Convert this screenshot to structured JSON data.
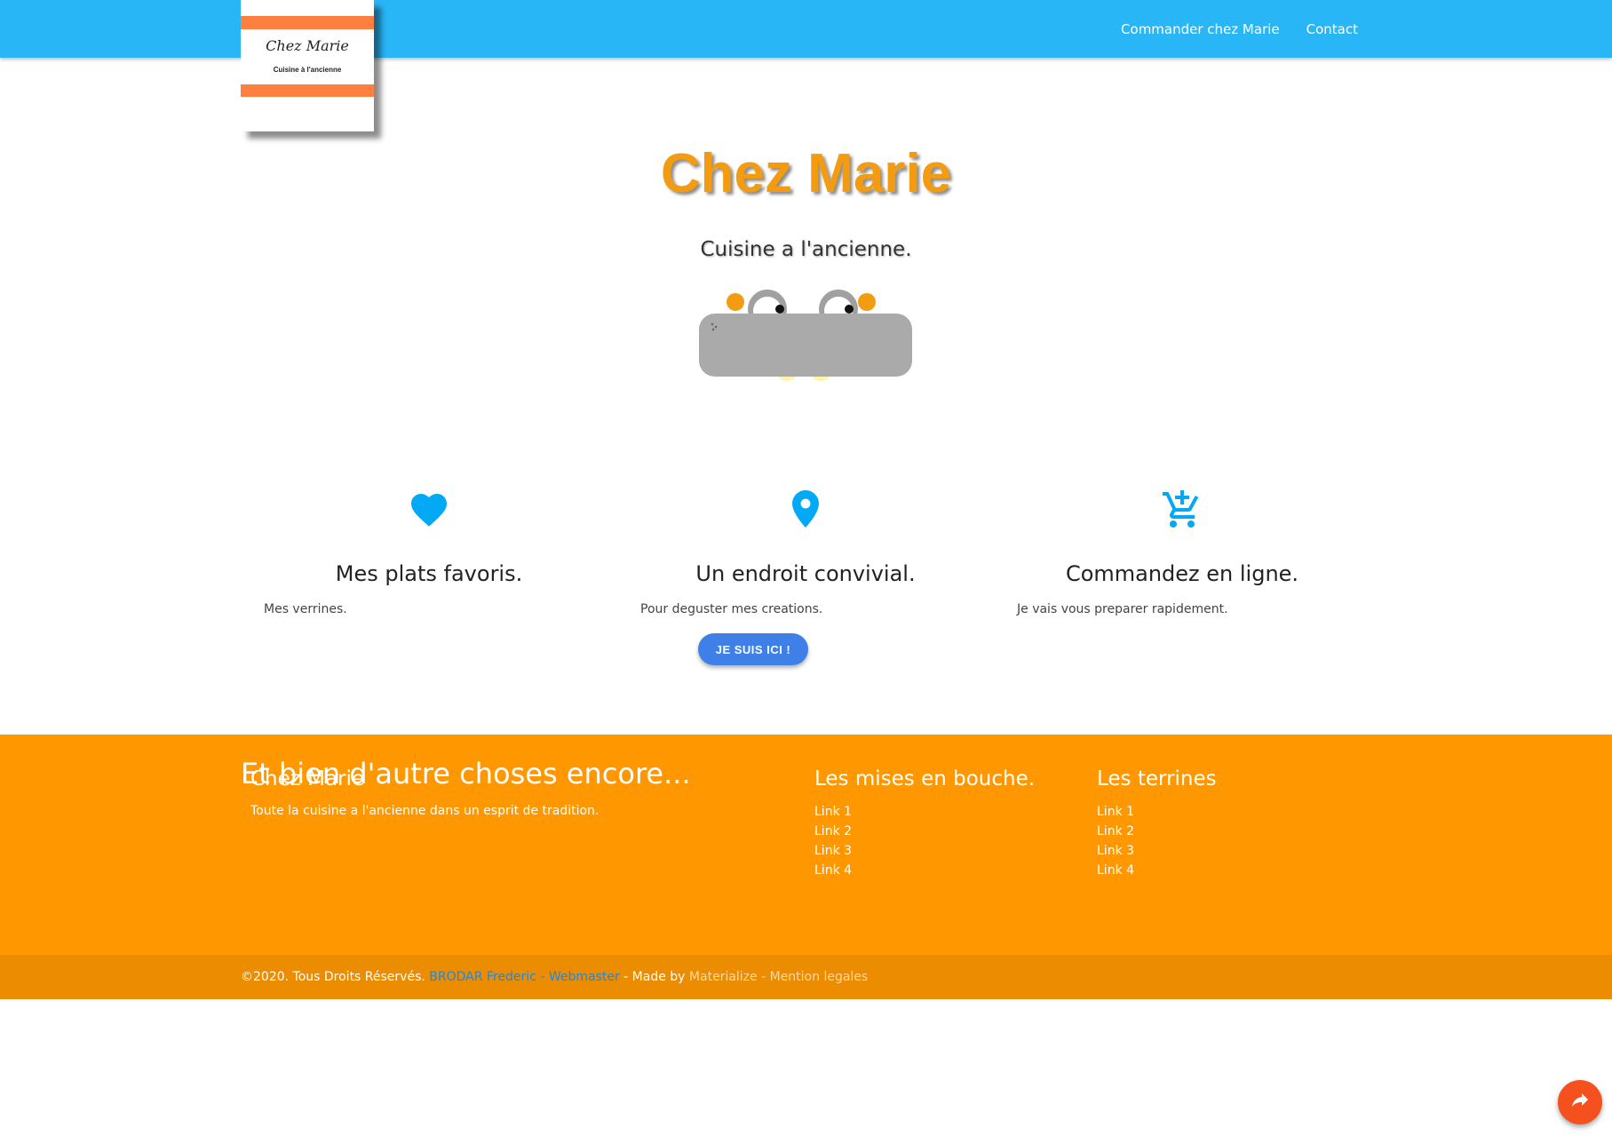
{
  "nav": {
    "links": [
      "Commander chez Marie",
      "Contact"
    ]
  },
  "logo": {
    "name": "Chez Marie",
    "tagline": "Cuisine à l'ancienne"
  },
  "hero": {
    "title": "Chez Marie",
    "subtitle": "Cuisine a l'ancienne."
  },
  "features": [
    {
      "icon": "heart-icon",
      "title": "Mes plats favoris.",
      "text": "Mes verrines."
    },
    {
      "icon": "map-pin-icon",
      "title": "Un endroit convivial.",
      "text": "Pour deguster mes creations."
    },
    {
      "icon": "add-shopping-cart-icon",
      "title": "Commandez en ligne.",
      "text": "Je vais vous preparer rapidement."
    }
  ],
  "cta": {
    "label": "JE SUIS ICI !"
  },
  "footer": {
    "about": {
      "title": "Chez Marie",
      "text": "Toute la cuisine a l'ancienne dans un esprit de tradition."
    },
    "col2": {
      "title": "Les mises en bouche.",
      "links": [
        "Link 1",
        "Link 2",
        "Link 3",
        "Link 4"
      ]
    },
    "col3": {
      "title": "Les terrines",
      "links": [
        "Link 1",
        "Link 2",
        "Link 3",
        "Link 4"
      ]
    },
    "slogan": "Et bien d'autre choses encore..."
  },
  "copyright": {
    "prefix": "©2020. Tous Droits Réservés.",
    "author": "BRODAR Frederic",
    "sep1": " - ",
    "role": "Webmaster",
    "made_by": " - Made by ",
    "framework": "Materialize",
    "sep2": " - ",
    "legal": "Mention legales"
  },
  "colors": {
    "navbar": "#29b6f6",
    "title": "#f39c12",
    "icon_blue": "#03a9f4",
    "footer": "#ff9800",
    "copyright_bar": "#ec8c00",
    "cta": "#3f7fe8",
    "fab": "#f4511e"
  }
}
